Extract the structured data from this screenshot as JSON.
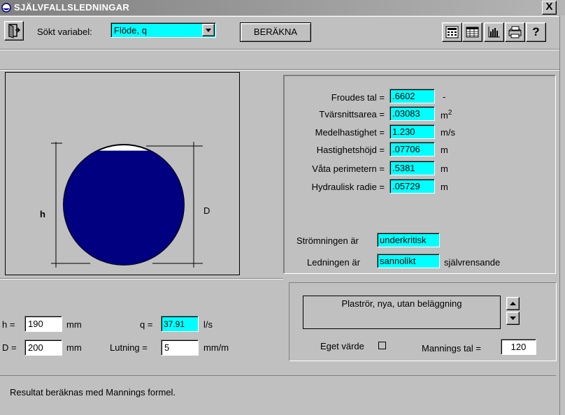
{
  "window": {
    "title": "SJÄLVFALLSLEDNINGAR",
    "close_label": "X"
  },
  "toolbar": {
    "variable_label": "Sökt variabel:",
    "variable_value": "Flöde, q",
    "compute_label": "BERÄKNA",
    "help_label": "?",
    "icons": [
      "exit-icon",
      "calculator-icon",
      "table-icon",
      "bar-chart-icon",
      "printer-icon",
      "help-icon"
    ]
  },
  "drawing": {
    "h_label": "h",
    "d_label": "D",
    "fill_color": "#000080",
    "fill_fraction": 0.95
  },
  "results": {
    "rows": [
      {
        "label": "Froudes tal =",
        "value": ".6602",
        "unit": "-"
      },
      {
        "label": "Tvärsnittsarea =",
        "value": ".03083",
        "unit": "m",
        "unit_sup": "2"
      },
      {
        "label": "Medelhastighet =",
        "value": "1.230",
        "unit": "m/s"
      },
      {
        "label": "Hastighetshöjd =",
        "value": ".07706",
        "unit": "m"
      },
      {
        "label": "Våta perimetern =",
        "value": ".5381",
        "unit": "m"
      },
      {
        "label": "Hydraulisk radie =",
        "value": ".05729",
        "unit": "m"
      }
    ],
    "flow_label": "Strömningen är",
    "flow_value": "underkritisk",
    "pipe_label": "Ledningen är",
    "pipe_value": "sannolikt",
    "pipe_suffix": "självrensande"
  },
  "inputs": {
    "h_label": "h  =",
    "h_value": "190",
    "h_unit": "mm",
    "d_label": "D  =",
    "d_value": "200",
    "d_unit": "mm",
    "q_label": "q =",
    "q_value": "37.91",
    "q_unit": "l/s",
    "slope_label": "Lutning =",
    "slope_value": "5",
    "slope_unit": "mm/m"
  },
  "material": {
    "selected": "Plaströr, nya, utan beläggning",
    "custom_label": "Eget värde",
    "custom_checked": false,
    "manning_label": "Mannings tal =",
    "manning_value": "120"
  },
  "status": {
    "text": "Resultat beräknas med Mannings formel."
  }
}
